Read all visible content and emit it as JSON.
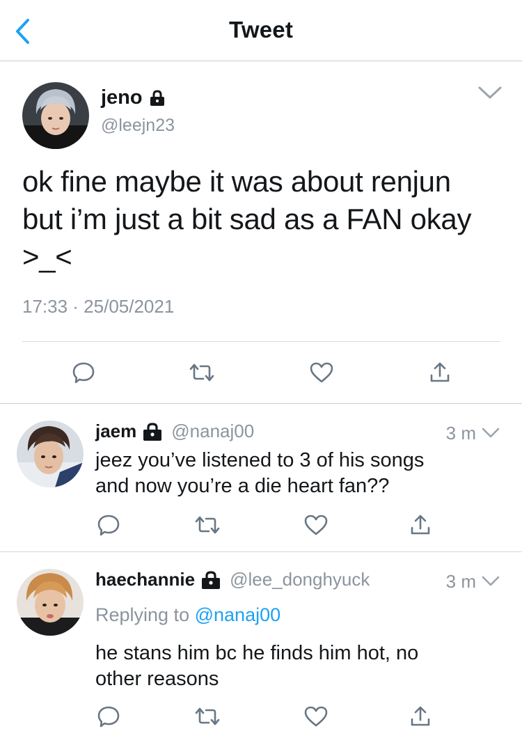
{
  "header": {
    "title": "Tweet",
    "back_icon": "chevron-left-icon"
  },
  "colors": {
    "accent": "#1da1f2",
    "text": "#14171a",
    "muted": "#8b949e",
    "icon": "#687684",
    "divider": "#c9ccd1"
  },
  "tweet": {
    "name": "jeno",
    "handle": "@leejn23",
    "locked_icon": "lock-icon",
    "text_lines": [
      "ok fine maybe it was about renjun",
      "but i’m just a bit sad as a FAN okay",
      ">_<"
    ],
    "timestamp": "17:33 · 25/05/2021",
    "menu_icon": "chevron-down-icon",
    "actions": [
      "reply-icon",
      "retweet-icon",
      "like-icon",
      "share-icon"
    ]
  },
  "replies": [
    {
      "name": "jaem",
      "handle": "@nanaj00",
      "time": "3 m",
      "locked_icon": "lock-icon",
      "text_lines": [
        "jeez you’ve listened to 3 of his songs",
        "and now you’re a die heart fan??"
      ],
      "actions": [
        "reply-icon",
        "retweet-icon",
        "like-icon",
        "share-icon"
      ]
    },
    {
      "name": "haechannie",
      "handle": "@lee_donghyuck",
      "time": "3 m",
      "locked_icon": "lock-icon",
      "replying_prefix": "Replying to",
      "replying_to": "@nanaj00",
      "text_lines": [
        "he stans him bc he finds him hot, no",
        "other reasons"
      ],
      "actions": [
        "reply-icon",
        "retweet-icon",
        "like-icon",
        "share-icon"
      ]
    }
  ]
}
